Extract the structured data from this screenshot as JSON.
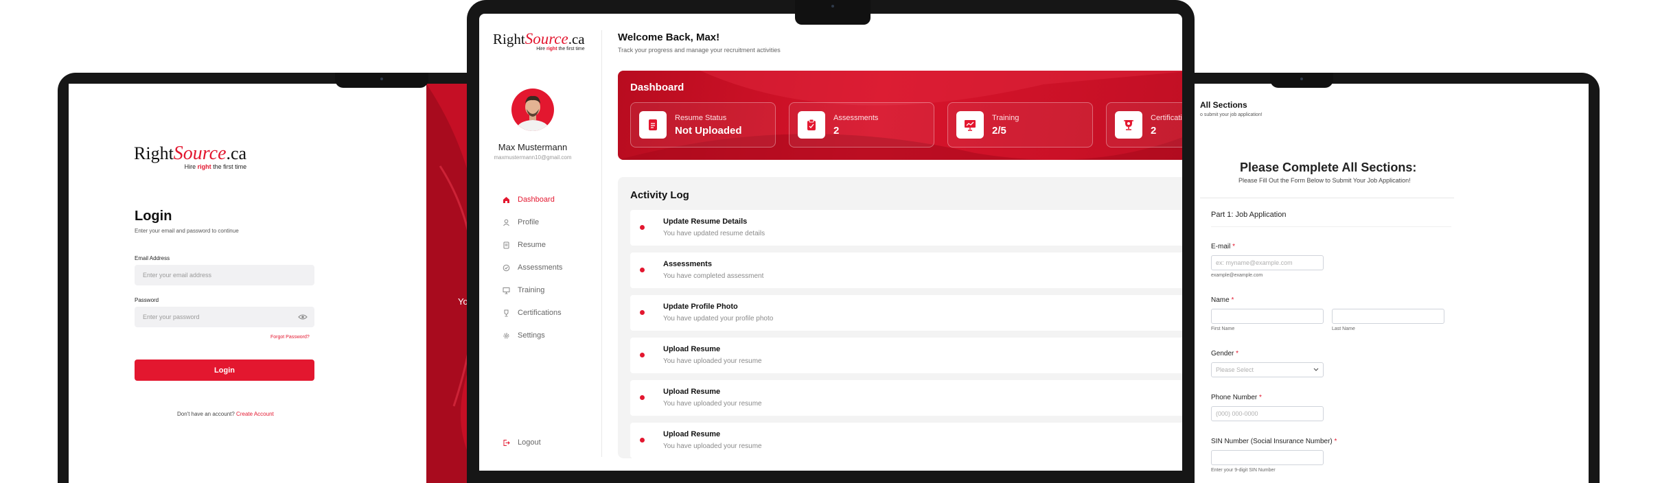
{
  "brand": {
    "logo_part1": "Right",
    "logo_part2": "Source",
    "logo_part3": ".ca",
    "tagline_pre": "Hire ",
    "tagline_bold": "right",
    "tagline_post": " the first time",
    "accent": "#e3172f",
    "dark_red": "#b80c1f"
  },
  "login": {
    "title": "Login",
    "subtitle": "Enter your email and password to continue",
    "email_label": "Email Address",
    "email_placeholder": "Enter your email address",
    "password_label": "Password",
    "password_placeholder": "Enter your password",
    "forgot_link": "Forgot Password?",
    "login_button": "Login",
    "no_account_text": "Don't have an account?",
    "create_account_link": "Create Account",
    "panel_text_fragment": "Yo"
  },
  "dashboard": {
    "welcome_title": "Welcome Back, Max!",
    "welcome_subtitle": "Track your progress and manage your recruitment activities",
    "user_name": "Max Mustermann",
    "user_email": "maxmustermann10@gmail.com",
    "nav": [
      {
        "label": "Dashboard",
        "icon": "home-icon",
        "active": true
      },
      {
        "label": "Profile",
        "icon": "user-icon",
        "active": false
      },
      {
        "label": "Resume",
        "icon": "document-icon",
        "active": false
      },
      {
        "label": "Assessments",
        "icon": "clipboard-icon",
        "active": false
      },
      {
        "label": "Training",
        "icon": "presentation-icon",
        "active": false
      },
      {
        "label": "Certifications",
        "icon": "trophy-icon",
        "active": false
      },
      {
        "label": "Settings",
        "icon": "gear-icon",
        "active": false
      }
    ],
    "logout_label": "Logout",
    "banner_title": "Dashboard",
    "cards": [
      {
        "label": "Resume Status",
        "value": "Not Uploaded",
        "icon": "resume-icon"
      },
      {
        "label": "Assessments",
        "value": "2",
        "icon": "assessment-icon"
      },
      {
        "label": "Training",
        "value": "2/5",
        "icon": "training-icon"
      },
      {
        "label": "Certifications",
        "value": "2",
        "icon": "certificate-icon"
      }
    ],
    "activity_title": "Activity Log",
    "activity": [
      {
        "title": "Update Resume Details",
        "desc": "You have updated resume details"
      },
      {
        "title": "Assessments",
        "desc": "You have completed assessment"
      },
      {
        "title": "Update Profile Photo",
        "desc": "You have updated your profile photo"
      },
      {
        "title": "Upload Resume",
        "desc": "You have uploaded your resume"
      },
      {
        "title": "Upload Resume",
        "desc": "You have uploaded your resume"
      },
      {
        "title": "Upload Resume",
        "desc": "You have uploaded your resume"
      }
    ]
  },
  "form": {
    "header_title": "All Sections",
    "header_subtitle": "o submit your job application!",
    "main_title": "Please Complete All Sections:",
    "main_subtitle": "Please Fill Out the Form Below to Submit Your Job Application!",
    "part_title": "Part 1: Job Application",
    "email_label": "E-mail",
    "email_placeholder": "ex: myname@example.com",
    "email_hint": "example@example.com",
    "name_label": "Name",
    "first_name_hint": "First Name",
    "last_name_hint": "Last Name",
    "gender_label": "Gender",
    "gender_placeholder": "Please Select",
    "phone_label": "Phone Number",
    "phone_placeholder": "(000) 000-0000",
    "sin_label": "SIN Number (Social Insurance Number)",
    "sin_hint": "Enter your 9-digit SIN Number",
    "required_mark": "*"
  }
}
